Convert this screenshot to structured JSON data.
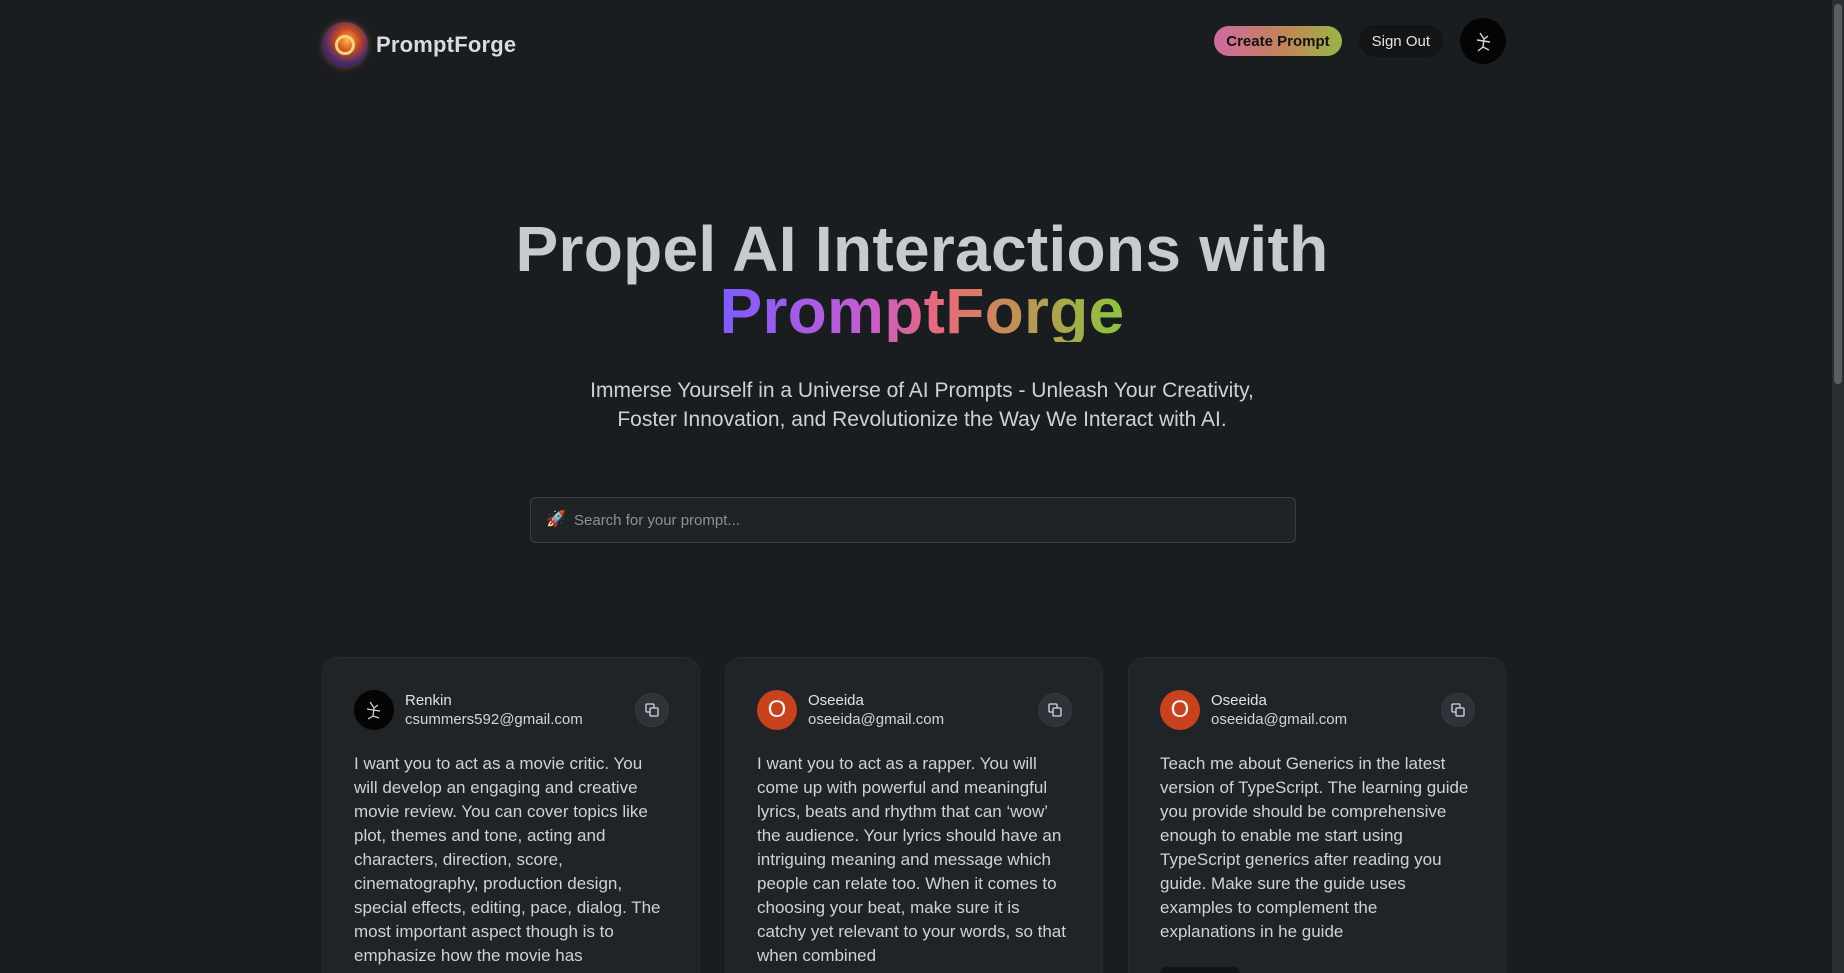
{
  "nav": {
    "brand_name": "PromptForge",
    "create_label": "Create Prompt",
    "signout_label": "Sign Out",
    "logo_icon": "flame-ring-logo",
    "profile_icon": "profile-avatar-icon"
  },
  "hero": {
    "title": "Propel AI Interactions with",
    "highlight": "PromptForge",
    "subtitle_line1": "Immerse Yourself in a Universe of AI Prompts - Unleash Your Creativity,",
    "subtitle_line2": "Foster Innovation, and Revolutionize the Way We Interact with AI."
  },
  "search": {
    "icon": "🚀",
    "placeholder": "Search for your prompt..."
  },
  "cards": [
    {
      "name": "Renkin",
      "email": "csummers592@gmail.com",
      "avatar_initial": "",
      "avatar_style": "dark",
      "text": "I want you to act as a movie critic. You will develop an engaging and creative movie review. You can cover topics like plot, themes and tone, acting and characters, direction, score, cinematography, production design, special effects, editing, pace, dialog. The most important aspect though is to emphasize how the movie has"
    },
    {
      "name": "Oseeida",
      "email": "oseeida@gmail.com",
      "avatar_initial": "O",
      "avatar_style": "orange",
      "text": "I want you to act as a rapper. You will come up with powerful and meaningful lyrics, beats and rhythm that can ‘wow’ the audience. Your lyrics should have an intriguing meaning and message which people can relate too. When it comes to choosing your beat, make sure it is catchy yet relevant to your words, so that when combined"
    },
    {
      "name": "Oseeida",
      "email": "oseeida@gmail.com",
      "avatar_initial": "O",
      "avatar_style": "orange",
      "text": "Teach me about Generics in the latest version of TypeScript. The learning guide you provide should be comprehensive enough to enable me start using TypeScript generics after reading you guide. Make sure the guide uses examples to complement the explanations in he guide"
    }
  ],
  "colors": {
    "background": "#1a1d20",
    "card": "#202427",
    "accent_orange": "#c7421d",
    "gradient_start": "#7b5cff",
    "gradient_end": "#8cc63f"
  }
}
